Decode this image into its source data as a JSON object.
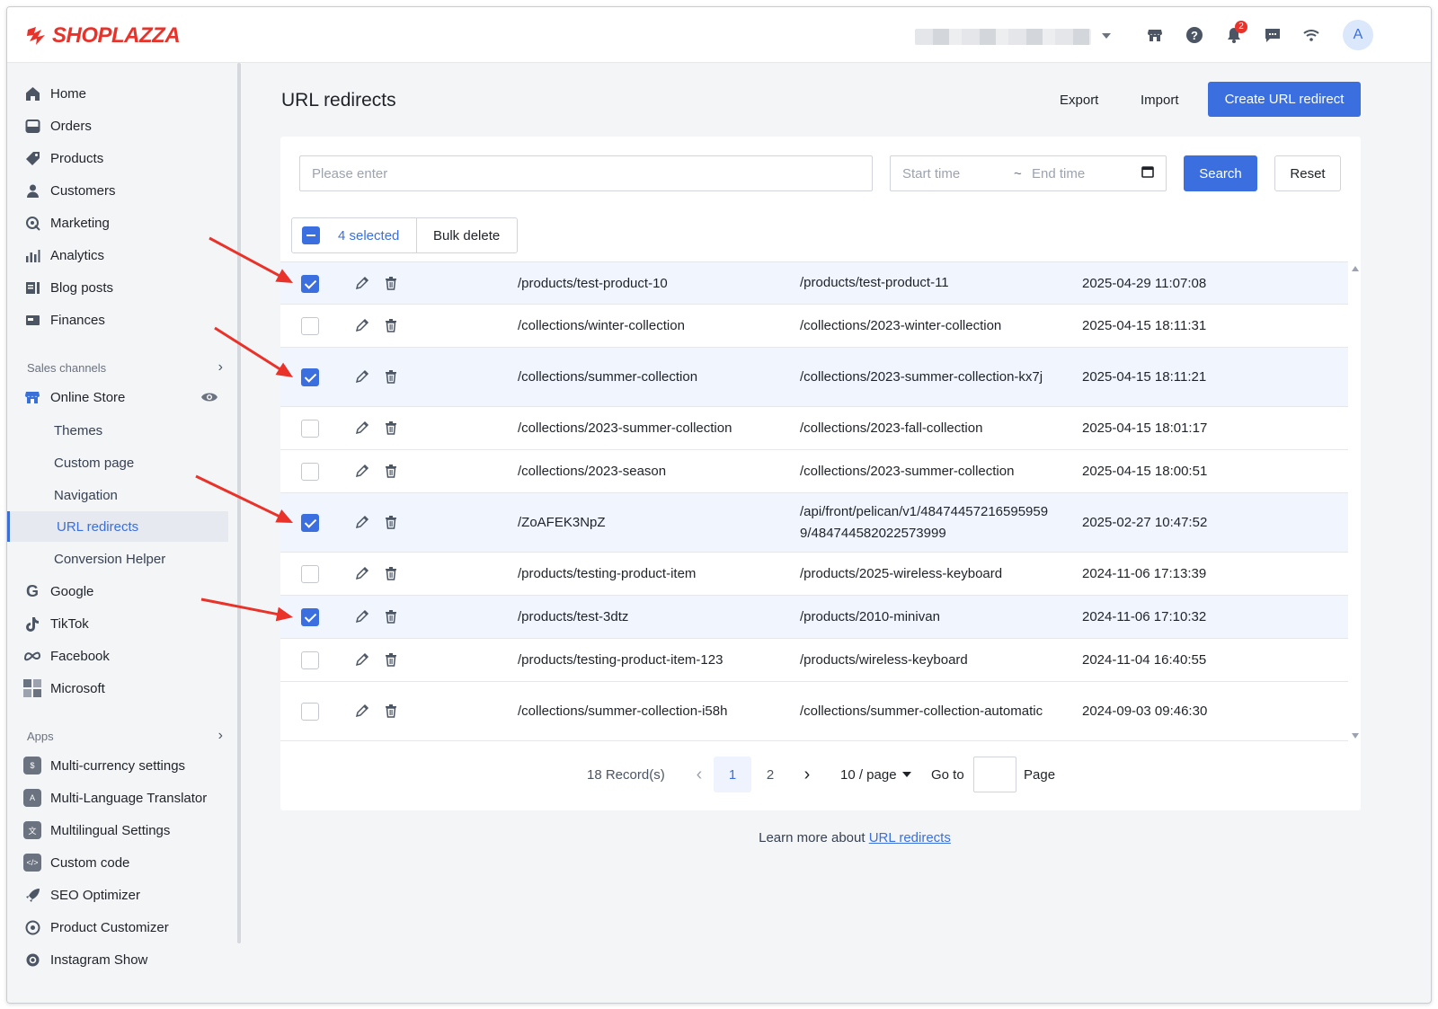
{
  "brand": {
    "name": "SHOPLAZZA",
    "color": "#e8322a"
  },
  "topbar": {
    "icons": [
      "store-icon",
      "help-icon",
      "bell-icon",
      "chat-icon",
      "wifi-icon"
    ],
    "notifications": "2",
    "avatar": "A"
  },
  "sidebar": {
    "main": [
      {
        "label": "Home",
        "icon": "home-icon"
      },
      {
        "label": "Orders",
        "icon": "orders-icon"
      },
      {
        "label": "Products",
        "icon": "tag-icon"
      },
      {
        "label": "Customers",
        "icon": "user-icon"
      },
      {
        "label": "Marketing",
        "icon": "marketing-icon"
      },
      {
        "label": "Analytics",
        "icon": "analytics-icon"
      },
      {
        "label": "Blog posts",
        "icon": "blog-icon"
      },
      {
        "label": "Finances",
        "icon": "finance-icon"
      }
    ],
    "sales_channels_label": "Sales channels",
    "online_store": "Online Store",
    "online_store_sub": [
      "Themes",
      "Custom page",
      "Navigation",
      "URL redirects",
      "Conversion Helper"
    ],
    "channels": [
      "Google",
      "TikTok",
      "Facebook",
      "Microsoft"
    ],
    "apps_label": "Apps",
    "apps": [
      "Multi-currency settings",
      "Multi-Language Translator",
      "Multilingual Settings",
      "Custom code",
      "SEO Optimizer",
      "Product Customizer",
      "Instagram Show"
    ]
  },
  "header": {
    "title": "URL redirects",
    "export": "Export",
    "import": "Import",
    "create": "Create URL redirect"
  },
  "filters": {
    "search_placeholder": "Please enter",
    "start_time": "Start time",
    "range_sep": "~",
    "end_time": "End time",
    "search_button": "Search",
    "reset_button": "Reset"
  },
  "bulk": {
    "selected": "4 selected",
    "delete": "Bulk delete"
  },
  "rows": [
    {
      "checked": true,
      "from": "/products/test-product-10",
      "to": "/products/test-product-11",
      "time": "2025-04-29 11:07:08"
    },
    {
      "checked": false,
      "from": "/collections/winter-collection",
      "to": "/collections/2023-winter-collection",
      "time": "2025-04-15 18:11:31"
    },
    {
      "checked": true,
      "from": "/collections/summer-collection",
      "to": "/collections/2023-summer-collection-kx7j",
      "time": "2025-04-15 18:11:21"
    },
    {
      "checked": false,
      "from": "/collections/2023-summer-collection",
      "to": "/collections/2023-fall-collection",
      "time": "2025-04-15 18:01:17"
    },
    {
      "checked": false,
      "from": "/collections/2023-season",
      "to": "/collections/2023-summer-collection",
      "time": "2025-04-15 18:00:51"
    },
    {
      "checked": true,
      "from": "/ZoAFEK3NpZ",
      "to": "/api/front/pelican/v1/484744572165959599/484744582022573999",
      "time": "2025-02-27 10:47:52"
    },
    {
      "checked": false,
      "from": "/products/testing-product-item",
      "to": "/products/2025-wireless-keyboard",
      "time": "2024-11-06 17:13:39"
    },
    {
      "checked": true,
      "from": "/products/test-3dtz",
      "to": "/products/2010-minivan",
      "time": "2024-11-06 17:10:32"
    },
    {
      "checked": false,
      "from": "/products/testing-product-item-123",
      "to": "/products/wireless-keyboard",
      "time": "2024-11-04 16:40:55"
    },
    {
      "checked": false,
      "from": "/collections/summer-collection-i58h",
      "to": "/collections/summer-collection-automatic",
      "time": "2024-09-03 09:46:30"
    }
  ],
  "pagination": {
    "records": "18 Record(s)",
    "pages": [
      "1",
      "2"
    ],
    "current": "1",
    "page_size": "10 / page",
    "goto": "Go to",
    "page_word": "Page"
  },
  "footer": {
    "text": "Learn more about",
    "link": "URL redirects"
  },
  "colors": {
    "accent": "#3b6fe0",
    "arrow": "#e8322a"
  }
}
